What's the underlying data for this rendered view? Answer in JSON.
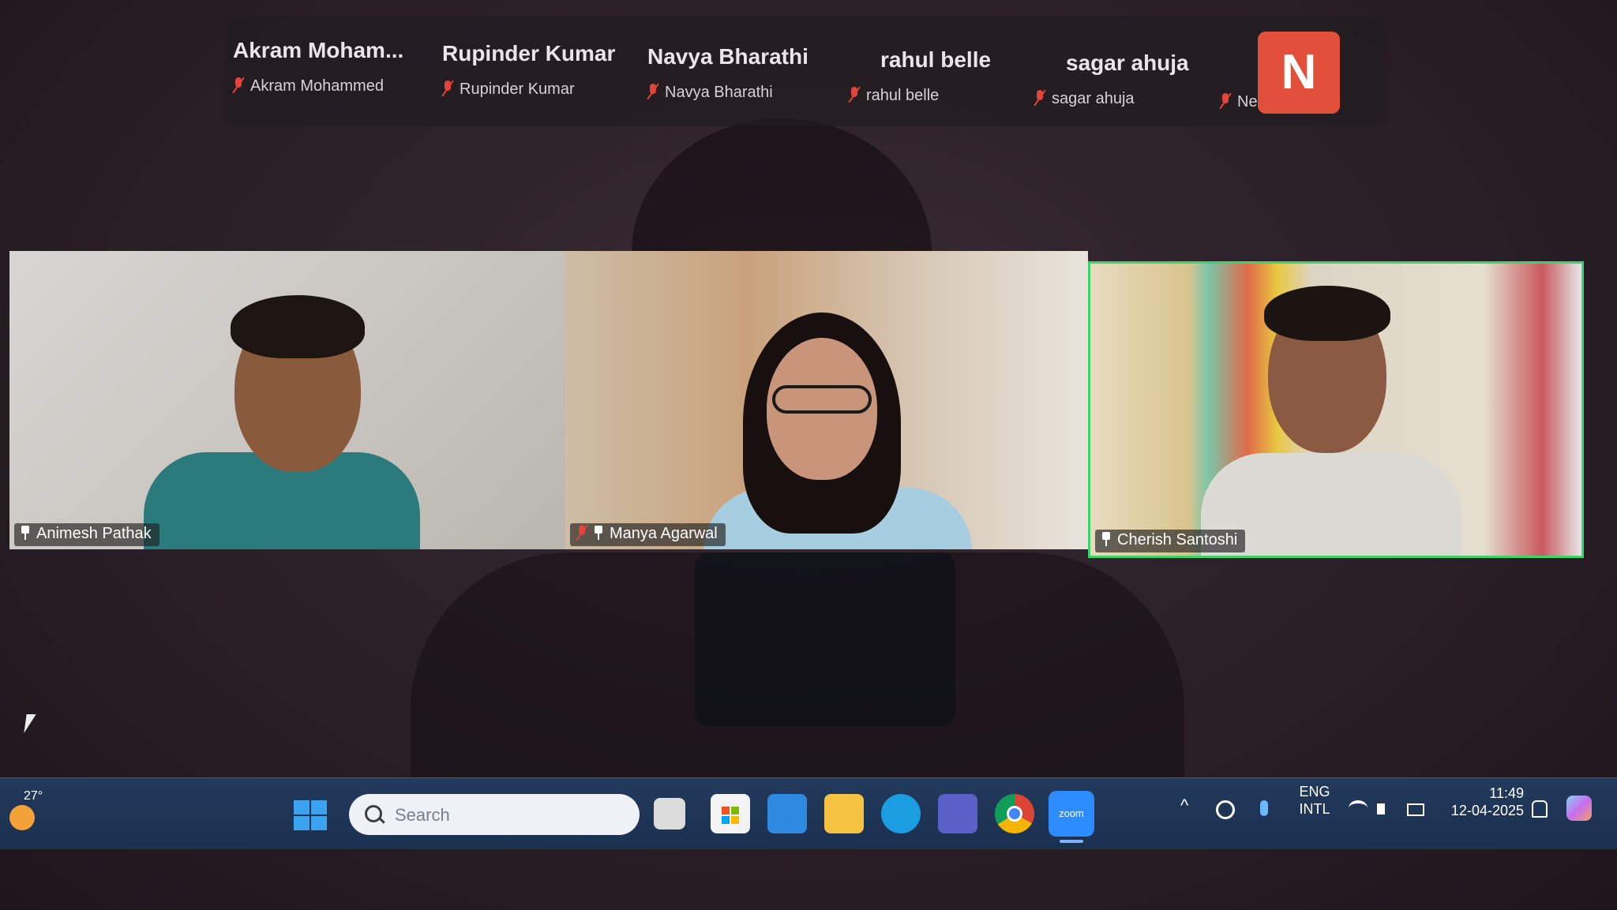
{
  "top_strip": {
    "participants": [
      {
        "display_name": "Akram  Moham...",
        "label": "Akram Mohammed"
      },
      {
        "display_name": "Rupinder Kumar",
        "label": "Rupinder Kumar"
      },
      {
        "display_name": "Navya Bharathi",
        "label": "Navya Bharathi"
      },
      {
        "display_name": "rahul belle",
        "label": "rahul belle"
      },
      {
        "display_name": "sagar ahuja",
        "label": "sagar ahuja"
      },
      {
        "display_name": "N",
        "label": "Neshanth M"
      }
    ]
  },
  "video_grid": {
    "tiles": [
      {
        "name": "Animesh Pathak"
      },
      {
        "name": "Manya Agarwal"
      },
      {
        "name": "Cherish Santoshi",
        "active_speaker_color": "#3ed36a"
      }
    ]
  },
  "taskbar": {
    "weather_temp": "27°",
    "search_placeholder": "Search",
    "language_line1": "ENG",
    "language_line2": "INTL",
    "time": "11:49",
    "date": "12-04-2025",
    "apps": [
      "task-view-icon",
      "microsoft-store-icon",
      "mail-icon",
      "file-explorer-icon",
      "edge-icon",
      "teams-icon",
      "chrome-icon",
      "zoom-icon"
    ],
    "zoom_label": "zoom"
  },
  "colors": {
    "mic_muted": "#e0443a",
    "avatar_bg": "#e2503b",
    "taskbar": "#223a5c"
  }
}
